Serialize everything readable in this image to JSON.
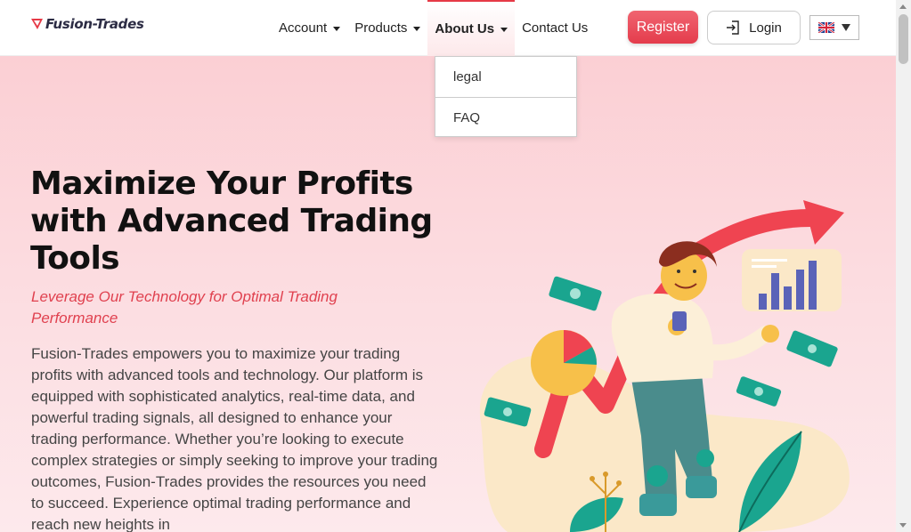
{
  "header": {
    "logo_text": "Fusion-Trades",
    "nav": [
      {
        "label": "Account",
        "has_caret": true
      },
      {
        "label": "Products",
        "has_caret": true
      },
      {
        "label": "About Us",
        "has_caret": true,
        "active": true
      },
      {
        "label": "Contact Us",
        "has_caret": false
      }
    ],
    "register_label": "Register",
    "login_label": "Login",
    "language_icon": "uk-flag-icon"
  },
  "dropdown": {
    "items": [
      "legal",
      "FAQ"
    ]
  },
  "hero": {
    "title": "Maximize Your Profits with Advanced Trading Tools",
    "subtitle": "Leverage Our Technology for Optimal Trading Performance",
    "body": "Fusion-Trades empowers you to maximize your trading profits with advanced tools and technology. Our platform is equipped with sophisticated analytics, real-time data, and powerful trading signals, all designed to enhance your trading performance. Whether you’re looking to execute complex strategies or simply seeking to improve your trading outcomes, Fusion-Trades provides the resources you need to succeed. Experience optimal trading performance and reach new heights in"
  },
  "colors": {
    "accent": "#e63946",
    "hero_bg": "#fbcfd4",
    "teal": "#1aa58f"
  }
}
